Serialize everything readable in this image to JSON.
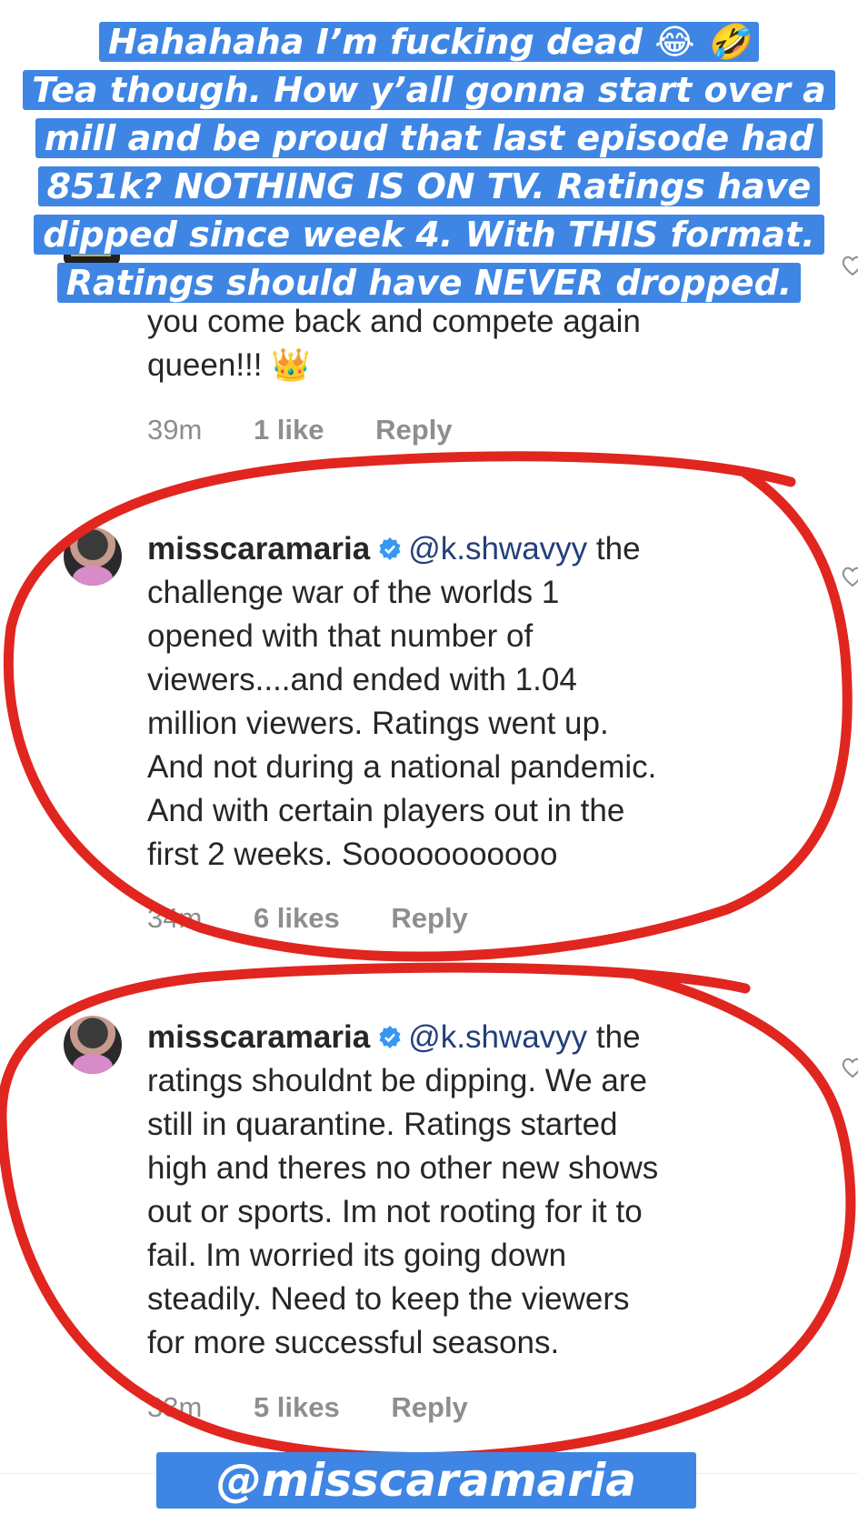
{
  "caption": {
    "lines": [
      "Hahahaha I’m fucking dead 😂 🤣",
      "Tea though. How y’all gonna start over a",
      "mill and be proud that last episode had",
      "851k? NOTHING IS ON TV. Ratings have",
      "dipped since week 4. With THIS format.",
      "Ratings should have NEVER dropped."
    ]
  },
  "comments": [
    {
      "text": "you come back and compete again\nqueen!!! 👑",
      "time": "39m",
      "likes": "1 like",
      "reply": "Reply"
    },
    {
      "username": "misscaramaria",
      "mention": "@k.shwavyy",
      "text": " the\nchallenge war of the worlds 1\nopened with that number of\nviewers....and ended with 1.04\nmillion viewers. Ratings went up.\nAnd not during a national pandemic.\nAnd with certain players out in the\nfirst 2 weeks. Sooooooooooo",
      "time": "34m",
      "likes": "6 likes",
      "reply": "Reply"
    },
    {
      "username": "misscaramaria",
      "mention": "@k.shwavyy",
      "text": " the\nratings shouldnt be dipping. We are\nstill in quarantine. Ratings started\nhigh and theres no other new shows\nout or sports. Im not rooting for it to\nfail. Im worried its going down\nsteadily. Need to keep the viewers\nfor more successful seasons.",
      "time": "33m",
      "likes": "5 likes",
      "reply": "Reply"
    }
  ],
  "footer_tag": "@misscaramaria",
  "colors": {
    "caption_bg": "#3f86e4",
    "annotation_red": "#e0261f",
    "verified_blue": "#3897f0",
    "mention_blue": "#233f7a",
    "meta_gray": "#8e8e8e"
  }
}
